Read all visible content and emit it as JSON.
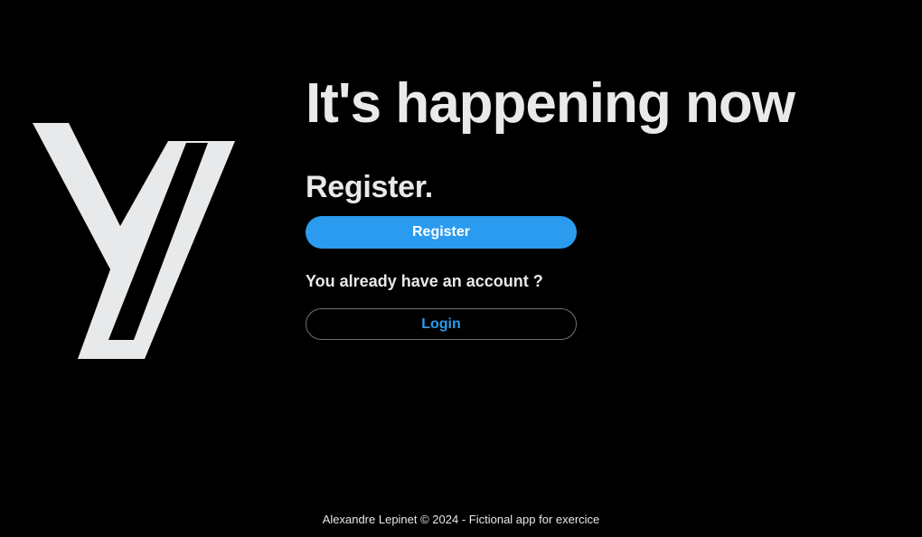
{
  "brand": {
    "logo_icon": "y-logo-icon",
    "logo_color": "#e7e9ea"
  },
  "main": {
    "headline": "It's happening now",
    "register_heading": "Register.",
    "register_button_label": "Register",
    "account_prompt": "You already have an account ?",
    "login_button_label": "Login"
  },
  "footer": {
    "text": "Alexandre Lepinet © 2024 - Fictional app for exercice"
  },
  "colors": {
    "background": "#000000",
    "text": "#e7e9ea",
    "accent": "#2a9bef",
    "login_border": "#6e7378"
  }
}
